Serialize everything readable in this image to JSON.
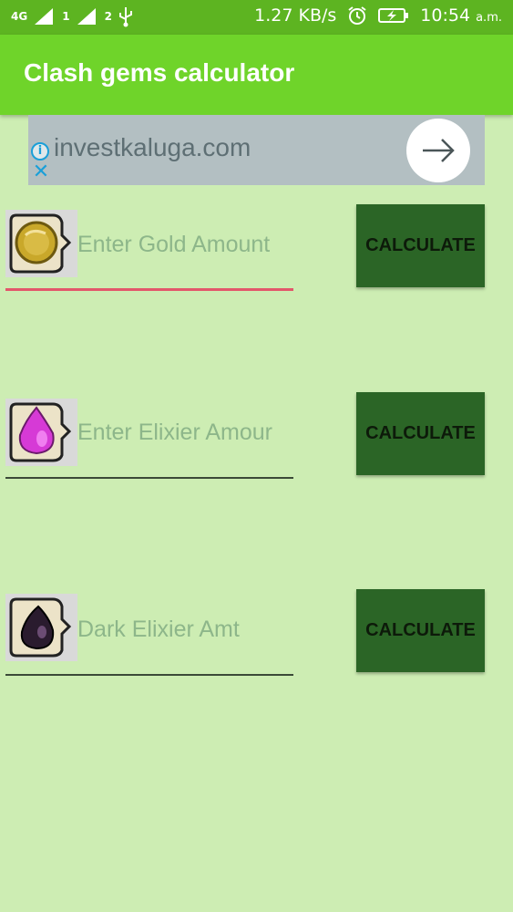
{
  "status_bar": {
    "network": "4G",
    "sim1": "1",
    "sim2": "2",
    "speed": "1.27 KB/s",
    "time": "10:54",
    "ampm": "a.m."
  },
  "app_bar": {
    "title": "Clash gems calculator"
  },
  "ad": {
    "domain": "investkaluga.com",
    "info_glyph": "i",
    "close_glyph": "✕"
  },
  "rows": [
    {
      "placeholder": "Enter Gold Amount",
      "button": "CALCULATE",
      "icon": "gold-coin-icon",
      "color": "#c9a82a"
    },
    {
      "placeholder": "Enter Elixier Amour",
      "button": "CALCULATE",
      "icon": "elixir-drop-icon",
      "color": "#d63ad6"
    },
    {
      "placeholder": "Dark Elixier Amt",
      "button": "CALCULATE",
      "icon": "dark-elixir-drop-icon",
      "color": "#2a1b2e"
    }
  ],
  "colors": {
    "status_bar": "#5db421",
    "app_bar": "#6fd42a",
    "background": "#cdedb3",
    "button": "#2b6526",
    "active_underline": "#e2576b"
  }
}
